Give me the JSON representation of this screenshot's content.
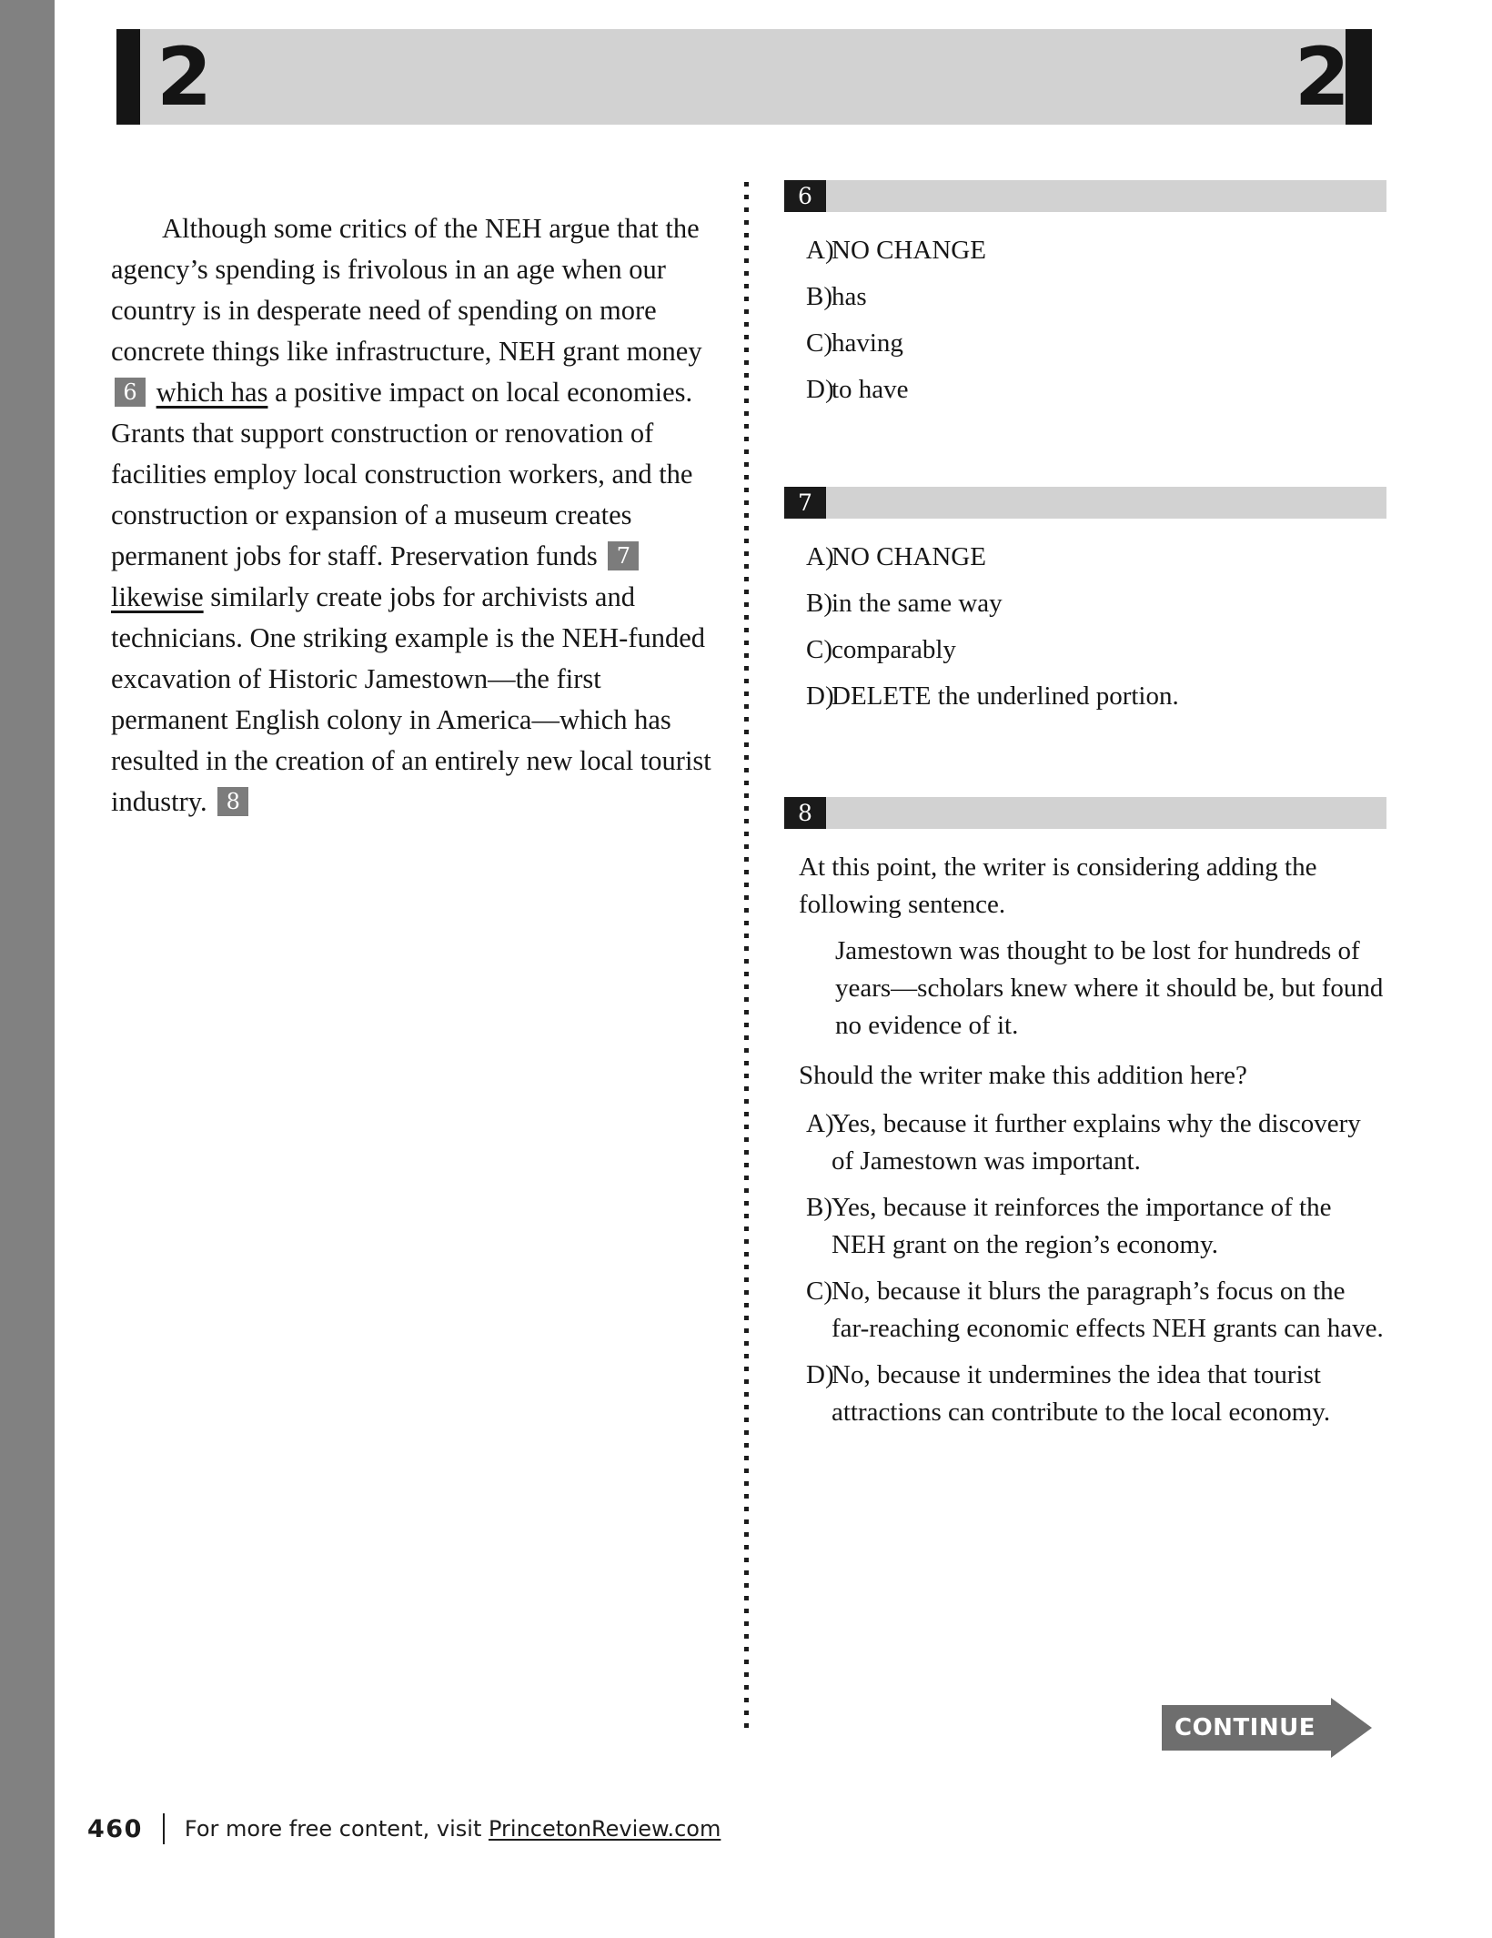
{
  "header": {
    "section_number_left": "2",
    "section_number_right": "2"
  },
  "passage": {
    "part1": "Although some critics of the NEH argue that the agency’s spending is frivolous in an age when our country is in desperate need of spending on more concrete things like infrastructure, NEH grant money",
    "ref6": "6",
    "underlined6": "which has",
    "part2": "a positive impact on local economies. Grants that support construction or renovation of facilities employ local construction workers, and the construction or expansion of a museum creates permanent jobs for staff. Preservation funds",
    "ref7": "7",
    "underlined7": "likewise",
    "part3": "similarly create jobs for archivists and technicians. One striking example is the NEH-funded excavation of Historic Jamestown—the first permanent English colony in America—which has resulted in the creation of an entirely new local tourist industry.",
    "ref8": "8"
  },
  "questions": [
    {
      "number": "6",
      "choices": [
        {
          "letter": "A)",
          "text": "NO CHANGE"
        },
        {
          "letter": "B)",
          "text": "has"
        },
        {
          "letter": "C)",
          "text": "having"
        },
        {
          "letter": "D)",
          "text": "to have"
        }
      ]
    },
    {
      "number": "7",
      "choices": [
        {
          "letter": "A)",
          "text": "NO CHANGE"
        },
        {
          "letter": "B)",
          "text": "in the same way"
        },
        {
          "letter": "C)",
          "text": "comparably"
        },
        {
          "letter": "D)",
          "text": "DELETE the underlined portion."
        }
      ]
    },
    {
      "number": "8",
      "stem": "At this point, the writer is considering adding the following sentence.",
      "inset": "Jamestown was thought to be lost for hundreds of years—scholars knew where it should be, but found no evidence of it.",
      "prompt": "Should the writer make this addition here?",
      "choices": [
        {
          "letter": "A)",
          "text": "Yes, because it further explains why the discovery of Jamestown was important."
        },
        {
          "letter": "B)",
          "text": "Yes, because it reinforces the importance of the NEH grant on the region’s economy."
        },
        {
          "letter": "C)",
          "text": "No, because it blurs the paragraph’s focus on the far-reaching economic effects NEH grants can have."
        },
        {
          "letter": "D)",
          "text": "No, because it undermines the idea that tourist attractions can contribute to the local economy."
        }
      ]
    }
  ],
  "continue_banner": {
    "label": "CONTINUE"
  },
  "footer": {
    "page_number": "460",
    "text": "For more free content, visit ",
    "link": "PrincetonReview.com"
  },
  "colors": {
    "spine_gray": "#818181",
    "header_bar_gray": "#d2d2d2",
    "badge_black": "#1a1a1a",
    "ref_box_gray": "#7c7c7c",
    "continue_gray": "#6e6e6e"
  }
}
